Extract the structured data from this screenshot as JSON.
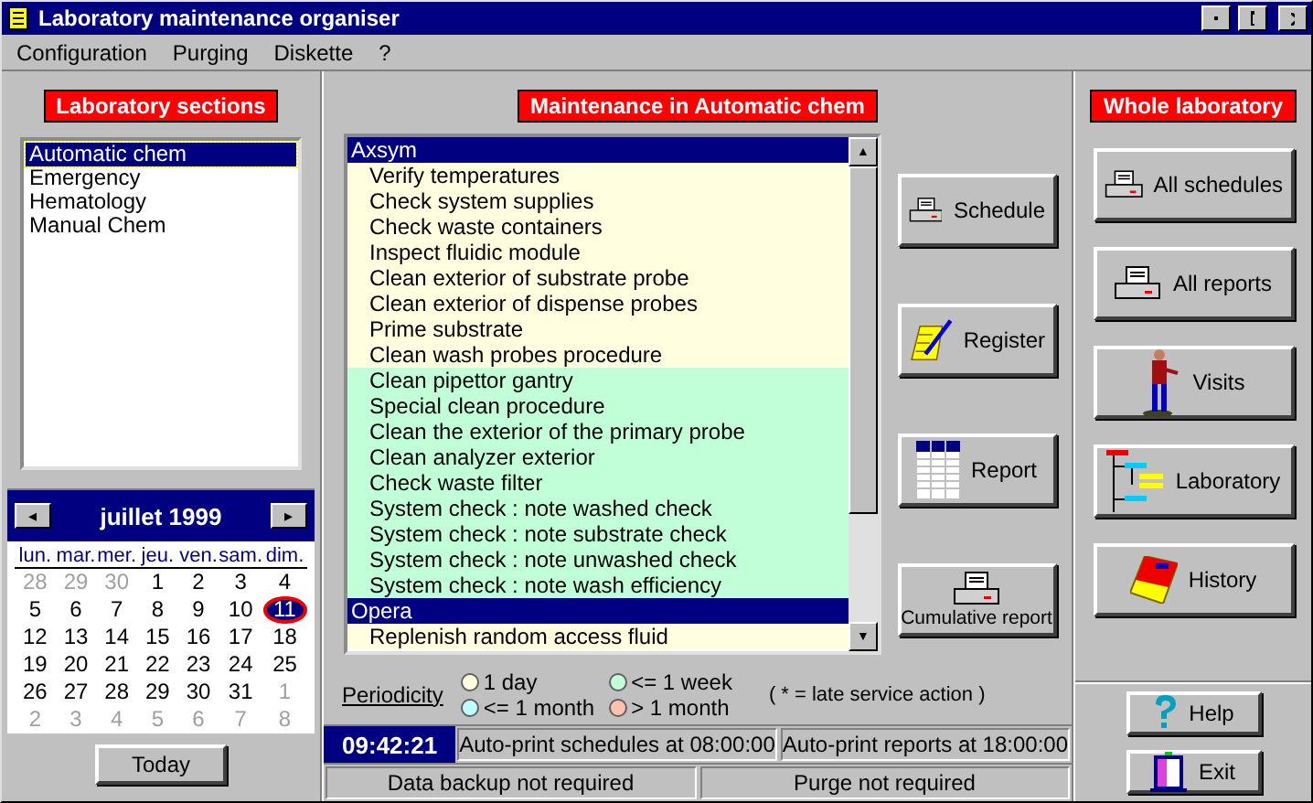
{
  "window": {
    "title": "Laboratory maintenance organiser"
  },
  "menu": [
    "Configuration",
    "Purging",
    "Diskette",
    "?"
  ],
  "sections": {
    "title": "Laboratory sections",
    "items": [
      {
        "label": "Automatic chem",
        "selected": true
      },
      {
        "label": "Emergency",
        "selected": false
      },
      {
        "label": "Hematology",
        "selected": false
      },
      {
        "label": "Manual Chem",
        "selected": false
      }
    ]
  },
  "calendar": {
    "prev": "◂",
    "next": "▸",
    "month": "juillet 1999",
    "weekdays": [
      "lun.",
      "mar.",
      "mer.",
      "jeu.",
      "ven.",
      "sam.",
      "dim."
    ],
    "days": [
      {
        "label": "28",
        "outside": true,
        "selected": false
      },
      {
        "label": "29",
        "outside": true,
        "selected": false
      },
      {
        "label": "30",
        "outside": true,
        "selected": false
      },
      {
        "label": "1",
        "outside": false,
        "selected": false
      },
      {
        "label": "2",
        "outside": false,
        "selected": false
      },
      {
        "label": "3",
        "outside": false,
        "selected": false
      },
      {
        "label": "4",
        "outside": false,
        "selected": false
      },
      {
        "label": "5",
        "outside": false,
        "selected": false
      },
      {
        "label": "6",
        "outside": false,
        "selected": false
      },
      {
        "label": "7",
        "outside": false,
        "selected": false
      },
      {
        "label": "8",
        "outside": false,
        "selected": false
      },
      {
        "label": "9",
        "outside": false,
        "selected": false
      },
      {
        "label": "10",
        "outside": false,
        "selected": false
      },
      {
        "label": "11",
        "outside": false,
        "selected": true
      },
      {
        "label": "12",
        "outside": false,
        "selected": false
      },
      {
        "label": "13",
        "outside": false,
        "selected": false
      },
      {
        "label": "14",
        "outside": false,
        "selected": false
      },
      {
        "label": "15",
        "outside": false,
        "selected": false
      },
      {
        "label": "16",
        "outside": false,
        "selected": false
      },
      {
        "label": "17",
        "outside": false,
        "selected": false
      },
      {
        "label": "18",
        "outside": false,
        "selected": false
      },
      {
        "label": "19",
        "outside": false,
        "selected": false
      },
      {
        "label": "20",
        "outside": false,
        "selected": false
      },
      {
        "label": "21",
        "outside": false,
        "selected": false
      },
      {
        "label": "22",
        "outside": false,
        "selected": false
      },
      {
        "label": "23",
        "outside": false,
        "selected": false
      },
      {
        "label": "24",
        "outside": false,
        "selected": false
      },
      {
        "label": "25",
        "outside": false,
        "selected": false
      },
      {
        "label": "26",
        "outside": false,
        "selected": false
      },
      {
        "label": "27",
        "outside": false,
        "selected": false
      },
      {
        "label": "28",
        "outside": false,
        "selected": false
      },
      {
        "label": "29",
        "outside": false,
        "selected": false
      },
      {
        "label": "30",
        "outside": false,
        "selected": false
      },
      {
        "label": "31",
        "outside": false,
        "selected": false
      },
      {
        "label": "1",
        "outside": true,
        "selected": false
      },
      {
        "label": "2",
        "outside": true,
        "selected": false
      },
      {
        "label": "3",
        "outside": true,
        "selected": false
      },
      {
        "label": "4",
        "outside": true,
        "selected": false
      },
      {
        "label": "5",
        "outside": true,
        "selected": false
      },
      {
        "label": "6",
        "outside": true,
        "selected": false
      },
      {
        "label": "7",
        "outside": true,
        "selected": false
      },
      {
        "label": "8",
        "outside": true,
        "selected": false
      }
    ],
    "today_button": "Today"
  },
  "maintenance": {
    "title": "Maintenance in Automatic chem",
    "rows": [
      {
        "kind": "group",
        "label": "Axsym"
      },
      {
        "kind": "task",
        "label": "Verify temperatures",
        "color": "#ffffe0"
      },
      {
        "kind": "task",
        "label": "Check system supplies",
        "color": "#ffffe0"
      },
      {
        "kind": "task",
        "label": "Check waste containers",
        "color": "#ffffe0"
      },
      {
        "kind": "task",
        "label": "Inspect fluidic module",
        "color": "#ffffe0"
      },
      {
        "kind": "task",
        "label": "Clean exterior of substrate probe",
        "color": "#ffffe0"
      },
      {
        "kind": "task",
        "label": "Clean exterior of dispense probes",
        "color": "#ffffe0"
      },
      {
        "kind": "task",
        "label": "Prime substrate",
        "color": "#ffffe0"
      },
      {
        "kind": "task",
        "label": "Clean wash probes procedure",
        "color": "#ffffe0"
      },
      {
        "kind": "task",
        "label": "Clean pipettor gantry",
        "color": "#c0ffd8"
      },
      {
        "kind": "task",
        "label": "Special clean procedure",
        "color": "#c0ffd8"
      },
      {
        "kind": "task",
        "label": "Clean the exterior of the primary probe",
        "color": "#c0ffd8"
      },
      {
        "kind": "task",
        "label": "Clean analyzer exterior",
        "color": "#c0ffd8"
      },
      {
        "kind": "task",
        "label": "Check waste filter",
        "color": "#c0ffd8"
      },
      {
        "kind": "task",
        "label": "System check : note washed check",
        "color": "#c0ffd8"
      },
      {
        "kind": "task",
        "label": "System check : note substrate check",
        "color": "#c0ffd8"
      },
      {
        "kind": "task",
        "label": "System check : note unwashed check",
        "color": "#c0ffd8"
      },
      {
        "kind": "task",
        "label": "System check : note wash efficiency",
        "color": "#c0ffd8"
      },
      {
        "kind": "group",
        "label": "Opera"
      },
      {
        "kind": "task",
        "label": "Replenish random access fluid",
        "color": "#ffffe0"
      }
    ],
    "scroll_up": "▲",
    "scroll_down": "▼"
  },
  "section_buttons": [
    {
      "kind": "printer",
      "label": "Schedule"
    },
    {
      "kind": "register",
      "label": "Register"
    },
    {
      "kind": "report",
      "label": "Report"
    },
    {
      "kind": "printer-stacked",
      "label": "Cumulative report"
    }
  ],
  "periodicity": {
    "label": "Periodicity",
    "legend": [
      {
        "label": "1 day",
        "color": "#ffffe0"
      },
      {
        "label": "<= 1 week",
        "color": "#c0ffd8"
      },
      {
        "label": "<= 1 month",
        "color": "#c0ffff"
      },
      {
        "label": "> 1 month",
        "color": "#ffc0b0"
      }
    ],
    "note": "( * = late service action )"
  },
  "status": {
    "time": "09:42:21",
    "schedules": "Auto-print schedules at 08:00:00",
    "reports": "Auto-print reports at 18:00:00",
    "backup": "Data backup not required",
    "purge": "Purge not required"
  },
  "whole": {
    "title": "Whole laboratory",
    "buttons": [
      {
        "kind": "printer",
        "label": "All schedules"
      },
      {
        "kind": "printer",
        "label": "All reports"
      },
      {
        "kind": "walker",
        "label": "Visits"
      },
      {
        "kind": "tree",
        "label": "Laboratory"
      },
      {
        "kind": "book",
        "label": "History"
      }
    ]
  },
  "footer_buttons": [
    {
      "kind": "help",
      "label": "Help"
    },
    {
      "kind": "exit",
      "label": "Exit"
    }
  ]
}
